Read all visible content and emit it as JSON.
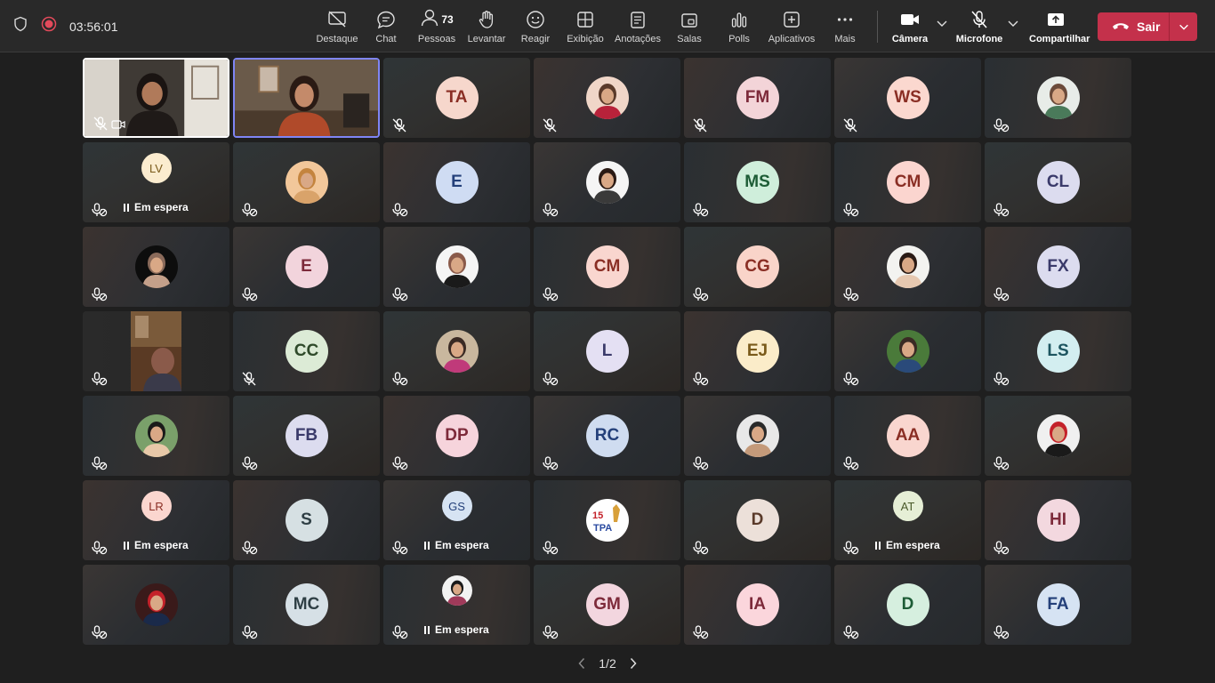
{
  "meeting": {
    "elapsed": "03:56:01"
  },
  "toolbar": {
    "spotlight": "Destaque",
    "chat": "Chat",
    "people": "Pessoas",
    "people_count": "73",
    "raise": "Levantar",
    "react": "Reagir",
    "view": "Exibição",
    "notes": "Anotações",
    "rooms": "Salas",
    "polls": "Polls",
    "apps": "Aplicativos",
    "more": "Mais",
    "camera": "Câmera",
    "mic": "Microfone",
    "share": "Compartilhar",
    "leave": "Sair"
  },
  "colors": {
    "leave": "#c4314b",
    "active_speaker_border": "#7f85f5",
    "background": "#1f1f1f"
  },
  "hold_text": "Em espera",
  "tiles": [
    {
      "kind": "video-self",
      "mic": "muted"
    },
    {
      "kind": "video-speaker",
      "mic": "none"
    },
    {
      "kind": "initials",
      "initials": "TA",
      "bg": "#f6d7cc",
      "fg": "#8a2e24",
      "mic": "muted"
    },
    {
      "kind": "photo",
      "photo": "woman-red",
      "mic": "muted"
    },
    {
      "kind": "initials",
      "initials": "FM",
      "bg": "#f3d4d8",
      "fg": "#7d2a3a",
      "mic": "muted"
    },
    {
      "kind": "initials",
      "initials": "WS",
      "bg": "#fbd8cf",
      "fg": "#8a2e24",
      "mic": "muted"
    },
    {
      "kind": "photo",
      "photo": "man-light",
      "mic": "off"
    },
    {
      "kind": "initials-hold",
      "initials": "LV",
      "bg": "#fbeccf",
      "fg": "#7a5a1a",
      "mic": "off"
    },
    {
      "kind": "photo",
      "photo": "woman-curly",
      "mic": "off"
    },
    {
      "kind": "initials",
      "initials": "E",
      "bg": "#cfdcf3",
      "fg": "#24407a",
      "mic": "off"
    },
    {
      "kind": "photo",
      "photo": "woman-dark",
      "mic": "off"
    },
    {
      "kind": "initials",
      "initials": "MS",
      "bg": "#cfeedb",
      "fg": "#1d5c36",
      "mic": "off"
    },
    {
      "kind": "initials",
      "initials": "CM",
      "bg": "#fbd5cf",
      "fg": "#8a2e24",
      "mic": "off"
    },
    {
      "kind": "initials",
      "initials": "CL",
      "bg": "#dcdcef",
      "fg": "#3a3a6a",
      "mic": "off"
    },
    {
      "kind": "photo",
      "photo": "woman-small",
      "mic": "off"
    },
    {
      "kind": "initials",
      "initials": "E",
      "bg": "#f2d4dc",
      "fg": "#7d2a3a",
      "mic": "off"
    },
    {
      "kind": "photo",
      "photo": "man-beard",
      "mic": "off"
    },
    {
      "kind": "initials",
      "initials": "CM",
      "bg": "#f9d6cf",
      "fg": "#8a2e24",
      "mic": "off"
    },
    {
      "kind": "initials",
      "initials": "CG",
      "bg": "#f9d4c9",
      "fg": "#8a2e24",
      "mic": "off"
    },
    {
      "kind": "photo",
      "photo": "woman-glasses",
      "mic": "off"
    },
    {
      "kind": "initials",
      "initials": "FX",
      "bg": "#dcdcef",
      "fg": "#3a3a6a",
      "mic": "off"
    },
    {
      "kind": "video-portrait",
      "mic": "off"
    },
    {
      "kind": "initials",
      "initials": "CC",
      "bg": "#dcebd6",
      "fg": "#2f4a2a",
      "mic": "muted"
    },
    {
      "kind": "photo",
      "photo": "man-pink",
      "mic": "off"
    },
    {
      "kind": "initials",
      "initials": "L",
      "bg": "#e4e0f3",
      "fg": "#3a3a6a",
      "mic": "off"
    },
    {
      "kind": "initials",
      "initials": "EJ",
      "bg": "#fbecc9",
      "fg": "#7a5a1a",
      "mic": "off"
    },
    {
      "kind": "photo",
      "photo": "man-outdoor",
      "mic": "off"
    },
    {
      "kind": "initials",
      "initials": "LS",
      "bg": "#d3eef0",
      "fg": "#1d5560",
      "mic": "off"
    },
    {
      "kind": "photo",
      "photo": "woman-sunglasses",
      "mic": "off"
    },
    {
      "kind": "initials",
      "initials": "FB",
      "bg": "#dcdcef",
      "fg": "#3a3a6a",
      "mic": "off"
    },
    {
      "kind": "initials",
      "initials": "DP",
      "bg": "#f6d4dc",
      "fg": "#7d2a3a",
      "mic": "off"
    },
    {
      "kind": "initials",
      "initials": "RC",
      "bg": "#cfdcf0",
      "fg": "#24407a",
      "mic": "off"
    },
    {
      "kind": "photo",
      "photo": "man-cap",
      "mic": "off"
    },
    {
      "kind": "initials",
      "initials": "AA",
      "bg": "#f9d6cf",
      "fg": "#8a2e24",
      "mic": "off"
    },
    {
      "kind": "photo",
      "photo": "man-red",
      "mic": "off"
    },
    {
      "kind": "initials-hold",
      "initials": "LR",
      "bg": "#fbd6cf",
      "fg": "#8a2e24",
      "mic": "off"
    },
    {
      "kind": "initials",
      "initials": "S",
      "bg": "#d6e0e3",
      "fg": "#2f3f45",
      "mic": "off"
    },
    {
      "kind": "initials-hold",
      "initials": "GS",
      "bg": "#d6e3f3",
      "fg": "#24407a",
      "mic": "off"
    },
    {
      "kind": "photo",
      "photo": "logo",
      "mic": "off"
    },
    {
      "kind": "initials",
      "initials": "D",
      "bg": "#ece0d9",
      "fg": "#5a3a2a",
      "mic": "off"
    },
    {
      "kind": "initials-hold",
      "initials": "AT",
      "bg": "#e6efd6",
      "fg": "#4a5a2a",
      "mic": "off"
    },
    {
      "kind": "initials",
      "initials": "HI",
      "bg": "#f3d8df",
      "fg": "#7d2a3a",
      "mic": "off"
    },
    {
      "kind": "photo",
      "photo": "man-suit",
      "mic": "off"
    },
    {
      "kind": "initials",
      "initials": "MC",
      "bg": "#d6e0e6",
      "fg": "#2f3f45",
      "mic": "off"
    },
    {
      "kind": "photo-hold",
      "photo": "man-young",
      "mic": "off"
    },
    {
      "kind": "initials",
      "initials": "GM",
      "bg": "#f3d6df",
      "fg": "#7d2a3a",
      "mic": "off"
    },
    {
      "kind": "initials",
      "initials": "IA",
      "bg": "#fbd6dc",
      "fg": "#7d2a3a",
      "mic": "off"
    },
    {
      "kind": "initials",
      "initials": "D",
      "bg": "#d6efdf",
      "fg": "#1d5c36",
      "mic": "off"
    },
    {
      "kind": "initials",
      "initials": "FA",
      "bg": "#d6e3f3",
      "fg": "#24407a",
      "mic": "off"
    }
  ],
  "pager": {
    "label": "1/2"
  }
}
